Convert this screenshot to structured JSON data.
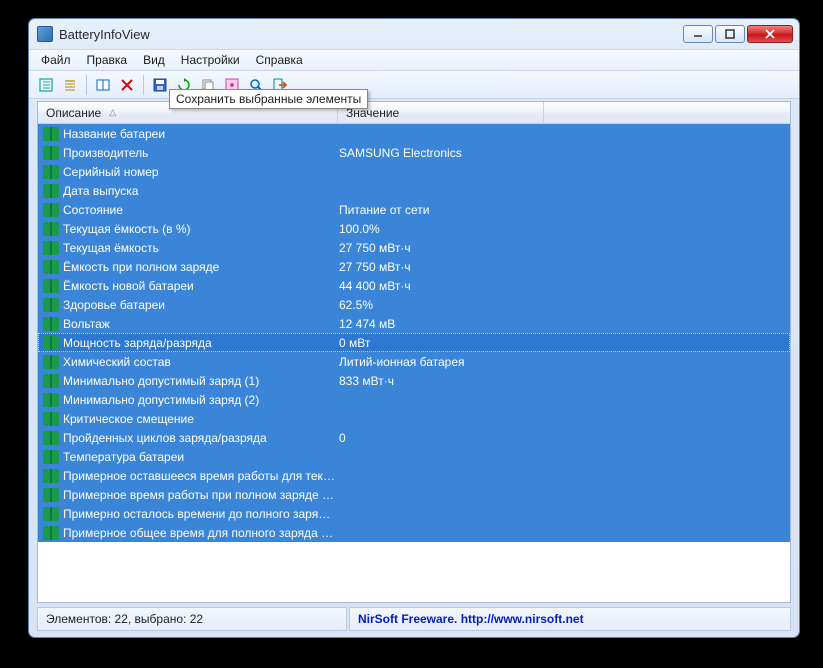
{
  "window": {
    "title": "BatteryInfoView"
  },
  "menu": {
    "items": [
      "Файл",
      "Правка",
      "Вид",
      "Настройки",
      "Справка"
    ]
  },
  "tooltip": "Сохранить выбранные элементы",
  "columns": {
    "desc": "Описание",
    "sort": "△",
    "value": "Значение"
  },
  "rows": [
    {
      "desc": "Название батареи",
      "value": ""
    },
    {
      "desc": "Производитель",
      "value": "SAMSUNG Electronics"
    },
    {
      "desc": "Серийный номер",
      "value": ""
    },
    {
      "desc": "Дата выпуска",
      "value": ""
    },
    {
      "desc": "Состояние",
      "value": "Питание от сети"
    },
    {
      "desc": "Текущая ёмкость (в %)",
      "value": "100.0%"
    },
    {
      "desc": "Текущая ёмкость",
      "value": "27 750 мВт·ч"
    },
    {
      "desc": "Ёмкость при полном заряде",
      "value": "27 750 мВт·ч"
    },
    {
      "desc": "Ёмкость новой батареи",
      "value": "44 400 мВт·ч"
    },
    {
      "desc": "Здоровье батареи",
      "value": "62.5%"
    },
    {
      "desc": "Вольтаж",
      "value": "12 474 мВ"
    },
    {
      "desc": "Мощность заряда/разряда",
      "value": "0 мВт",
      "focused": true
    },
    {
      "desc": "Химический состав",
      "value": "Литий-ионная батарея"
    },
    {
      "desc": "Минимально допустимый заряд (1)",
      "value": "833 мВт·ч"
    },
    {
      "desc": "Минимально допустимый заряд (2)",
      "value": ""
    },
    {
      "desc": "Критическое смещение",
      "value": ""
    },
    {
      "desc": "Пройденных циклов заряда/разряда",
      "value": "0"
    },
    {
      "desc": "Температура батареи",
      "value": ""
    },
    {
      "desc": "Примерное оставшееся время работы для теку...",
      "value": ""
    },
    {
      "desc": "Примерное время работы при полном заряде д...",
      "value": ""
    },
    {
      "desc": "Примерно осталось времени до полного заряд...",
      "value": ""
    },
    {
      "desc": "Примерное общее время для полного заряда б...",
      "value": ""
    }
  ],
  "status": {
    "left": "Элементов: 22, выбрано: 22",
    "right": "NirSoft Freeware.  http://www.nirsoft.net"
  }
}
